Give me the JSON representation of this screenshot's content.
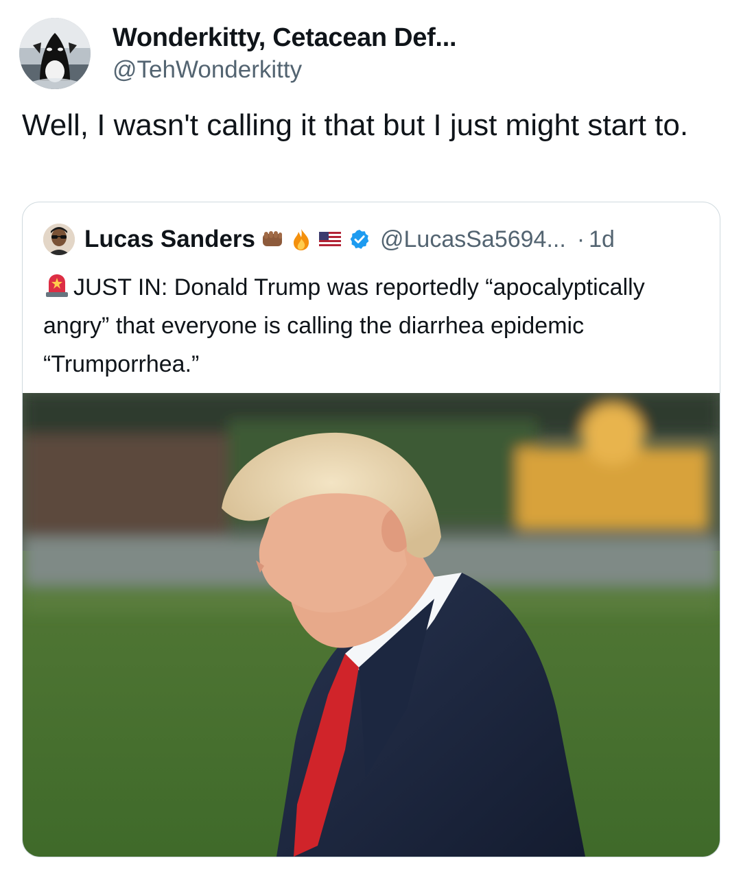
{
  "tweet": {
    "author": {
      "display_name": "Wonderkitty, Cetacean Def...",
      "handle": "@TehWonderkitty",
      "avatar": "orca-avatar"
    },
    "text": "Well, I wasn't calling it that but I just might start to."
  },
  "quoted_tweet": {
    "author": {
      "display_name": "Lucas Sanders",
      "handle": "@LucasSa5694...",
      "name_emojis": [
        "fist-emoji",
        "fire-emoji",
        "us-flag-emoji"
      ],
      "verified": true,
      "avatar": "person-with-sunglasses-avatar"
    },
    "separator": "·",
    "time": "1d",
    "siren_icon": "siren-emoji",
    "text": "JUST IN: Donald Trump was reportedly “apocalyptically angry” that everyone is calling the diarrhea epidemic “Trumporrhea.”",
    "image": "photo-man-in-suit-outdoors"
  },
  "colors": {
    "text_primary": "#0f1419",
    "text_secondary": "#536471",
    "border": "#cfd9de",
    "verified_blue": "#1d9bf0"
  }
}
